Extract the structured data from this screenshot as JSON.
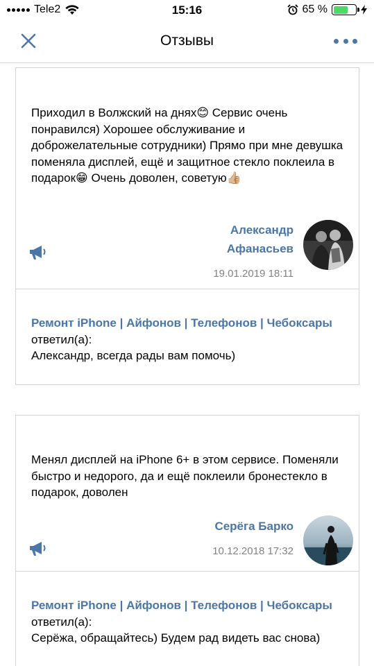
{
  "status_bar": {
    "carrier": "Tele2",
    "time": "15:16",
    "battery_percent": "65 %",
    "battery_level": 0.65,
    "battery_color": "#4cd964"
  },
  "header": {
    "title": "Отзывы",
    "close_icon": "close-icon",
    "more_icon": "more-dots-icon",
    "accent_color": "#4a76a8"
  },
  "reviews": [
    {
      "text": "Приходил в Волжский на днях😊 Сервис очень понравился) Хорошее обслуживание и доброжелательные сотрудники) Прямо при мне девушка поменяла дисплей, ещё и защитное стекло поклеила в подарок😁 Очень доволен, советую👍🏼",
      "author_first": "Александр",
      "author_last": "Афанасьев",
      "date": "19.01.2019 18:11",
      "reply_company": "Ремонт iPhone | Айфонов | Телефонов | Чебоксары",
      "reply_verb": "ответил(а):",
      "reply_text": "Александр, всегда рады вам помочь)"
    },
    {
      "text": "Менял дисплей на iPhone 6+ в этом сервисе. Поменяли быстро и недорого, да и ещё поклеили бронестекло в подарок, доволен",
      "author": "Серёга Барко",
      "date": "10.12.2018 17:32",
      "reply_company": "Ремонт iPhone | Айфонов | Телефонов | Чебоксары",
      "reply_verb": "ответил(а):",
      "reply_text": "Серёжа, обращайтесь) Будем рад видеть вас снова)"
    }
  ]
}
